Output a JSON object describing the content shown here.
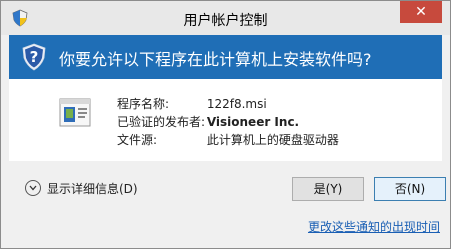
{
  "window": {
    "title": "用户帐户控制",
    "close_glyph": "✕"
  },
  "banner": {
    "question": "你要允许以下程序在此计算机上安装软件吗?"
  },
  "details": {
    "program_label": "程序名称:",
    "program_value": "122f8.msi",
    "publisher_label": "已验证的发布者:",
    "publisher_value": "Visioneer Inc.",
    "source_label": "文件源:",
    "source_value": "此计算机上的硬盘驱动器"
  },
  "footer": {
    "show_details": "显示详细信息(D)",
    "yes_button": "是(Y)",
    "no_button": "否(N)",
    "change_link": "更改这些通知的出现时间"
  },
  "colors": {
    "banner_blue": "#1f6eb6",
    "close_red": "#c74a3d",
    "link_blue": "#1a5fb4"
  },
  "icons": {
    "title": "uac-shield-icon",
    "banner": "question-shield-icon",
    "program": "installer-package-icon",
    "details": "chevron-down-icon"
  }
}
